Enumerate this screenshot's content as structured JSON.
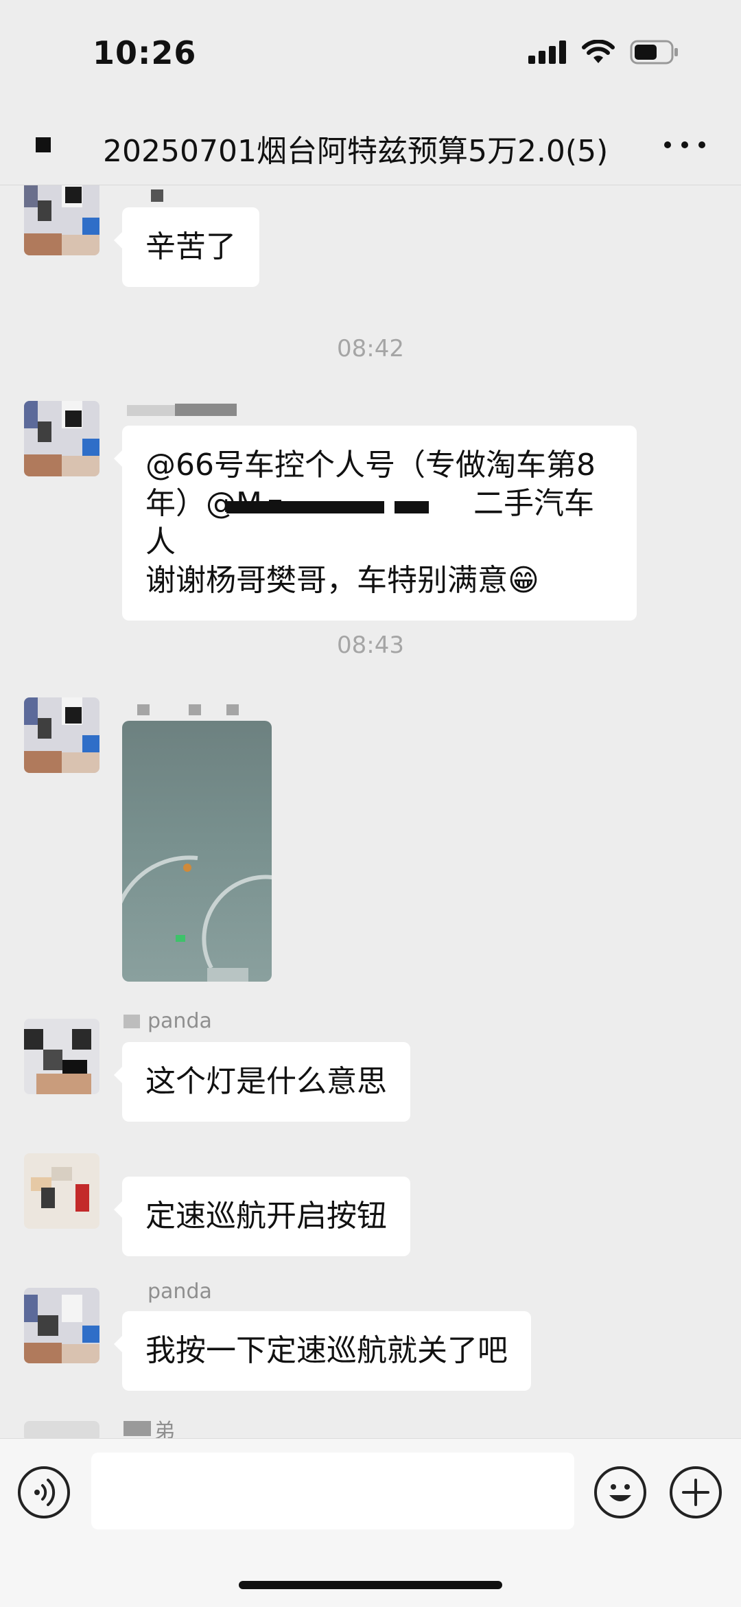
{
  "status_bar": {
    "time": "10:26"
  },
  "header": {
    "title": "20250701烟台阿特兹预算5万2.0(5)"
  },
  "messages": [
    {
      "type": "text",
      "nick": "",
      "text": "辛苦了"
    },
    {
      "type": "time",
      "text": "08:42"
    },
    {
      "type": "text",
      "nick": "",
      "lines": [
        "@66号车控个人号（专做淘车第8",
        "年）@M　　　　　　　二手汽车人",
        "谢谢杨哥樊哥，车特别满意😁"
      ]
    },
    {
      "type": "time",
      "text": "08:43"
    },
    {
      "type": "image",
      "nick": ""
    },
    {
      "type": "text",
      "nick": "panda",
      "text": "这个灯是什么意思"
    },
    {
      "type": "text",
      "nick": "",
      "text": "定速巡航开启按钮"
    },
    {
      "type": "text",
      "nick": "panda",
      "text": "我按一下定速巡航就关了吧"
    },
    {
      "type": "partial",
      "nick": "弟"
    }
  ],
  "input_bar": {
    "voice_icon": "voice-icon",
    "emoji_icon": "emoji-icon",
    "plus_icon": "plus-icon",
    "placeholder": ""
  }
}
